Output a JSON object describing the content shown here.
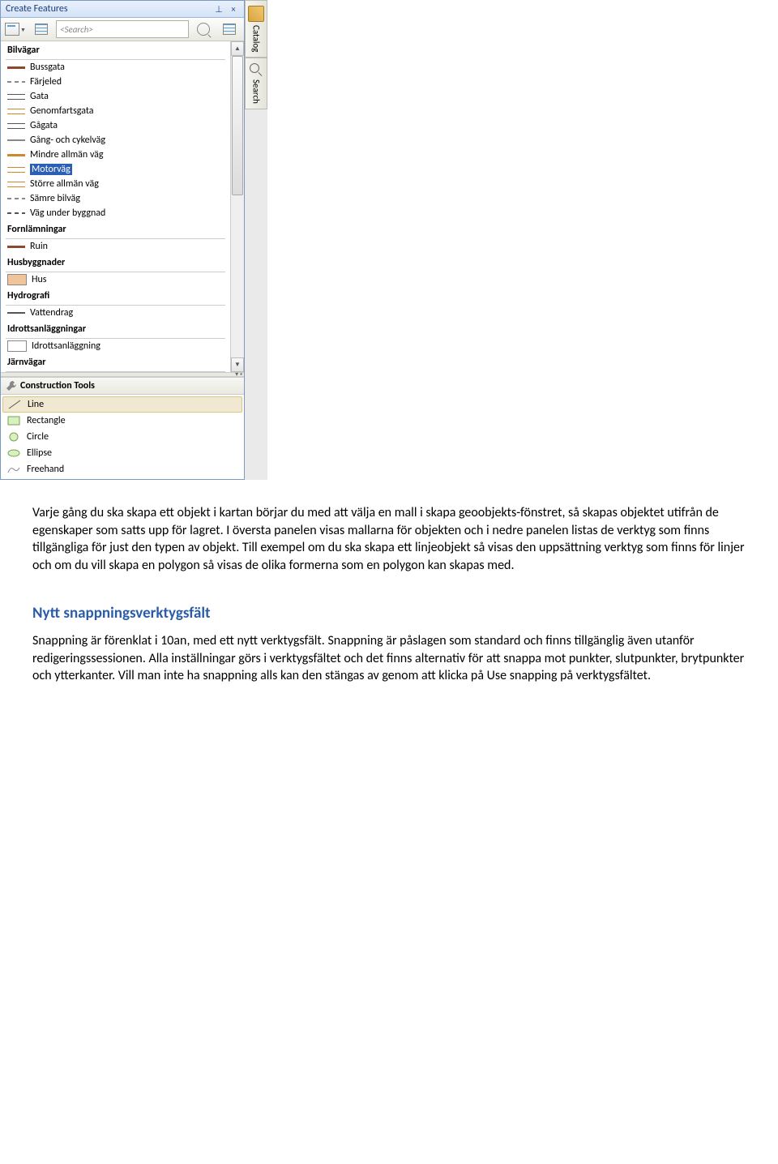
{
  "panel": {
    "title": "Create Features",
    "search_placeholder": "<Search>",
    "sections": {
      "bilvagar": {
        "header": "Bilvägar",
        "items": [
          "Bussgata",
          "Färjeled",
          "Gata",
          "Genomfartsgata",
          "Gågata",
          "Gång- och cykelväg",
          "Mindre allmän väg",
          "Motorväg",
          "Större allmän väg",
          "Sämre bilväg",
          "Väg under byggnad"
        ]
      },
      "fornlamningar": {
        "header": "Fornlämningar",
        "items": [
          "Ruin"
        ]
      },
      "husbyggnader": {
        "header": "Husbyggnader",
        "items": [
          "Hus"
        ]
      },
      "hydrografi": {
        "header": "Hydrografi",
        "items": [
          "Vattendrag"
        ]
      },
      "idrott": {
        "header": "Idrottsanläggningar",
        "items": [
          "Idrottsanläggning"
        ]
      },
      "jarnvagar": {
        "header": "Järnvägar"
      }
    },
    "construction_tools": {
      "header": "Construction Tools",
      "tools": [
        "Line",
        "Rectangle",
        "Circle",
        "Ellipse",
        "Freehand"
      ]
    }
  },
  "sidetabs": {
    "catalog": "Catalog",
    "search": "Search"
  },
  "doc": {
    "p1": "Varje gång du ska skapa ett objekt i kartan börjar du med att välja en mall i skapa geoobjekts-fönstret, så skapas objektet utifrån de egenskaper som satts upp för lagret. I översta panelen visas mallarna för objekten och i nedre panelen listas de verktyg som finns tillgängliga för just den typen av objekt. Till exempel om du ska skapa ett linjeobjekt så visas den uppsättning verktyg som finns för linjer och om du vill skapa en polygon så visas de olika formerna som en polygon kan skapas med.",
    "h1": "Nytt snappningsverktygsfält",
    "p2": "Snappning är förenklat i 10an, med ett nytt verktygsfält. Snappning är påslagen som standard och finns tillgänglig även utanför redigeringssessionen. Alla inställningar görs i verktygsfältet och det finns alternativ för att snappa mot punkter, slutpunkter, brytpunkter och ytterkanter. Vill man inte ha snappning alls kan den stängas av genom att klicka på Use snapping på verktygsfältet."
  }
}
